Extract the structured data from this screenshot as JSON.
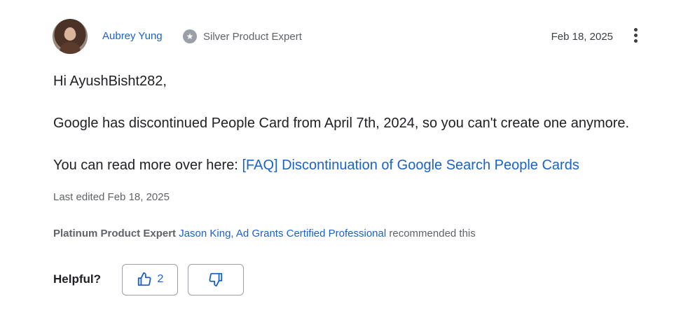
{
  "author": {
    "name": "Aubrey Yung",
    "badge_label": "Silver Product Expert",
    "badge_icon": "star-icon"
  },
  "post": {
    "date": "Feb 18, 2025",
    "greeting": "Hi AyushBisht282,",
    "paragraph_1": "Google has discontinued People Card from April 7th, 2024, so you can't create one anymore.",
    "paragraph_2_prefix": "You can read more over here: ",
    "paragraph_2_link": "[FAQ] Discontinuation of Google Search People Cards",
    "last_edited": "Last edited Feb 18, 2025"
  },
  "recommendation": {
    "level": "Platinum Product Expert",
    "recommender": "Jason King, Ad Grants Certified Professional",
    "suffix": "recommended this"
  },
  "feedback": {
    "label": "Helpful?",
    "upvote_count": "2"
  },
  "colors": {
    "link": "#1a62c8",
    "muted": "#5f6368",
    "text": "#202124"
  }
}
